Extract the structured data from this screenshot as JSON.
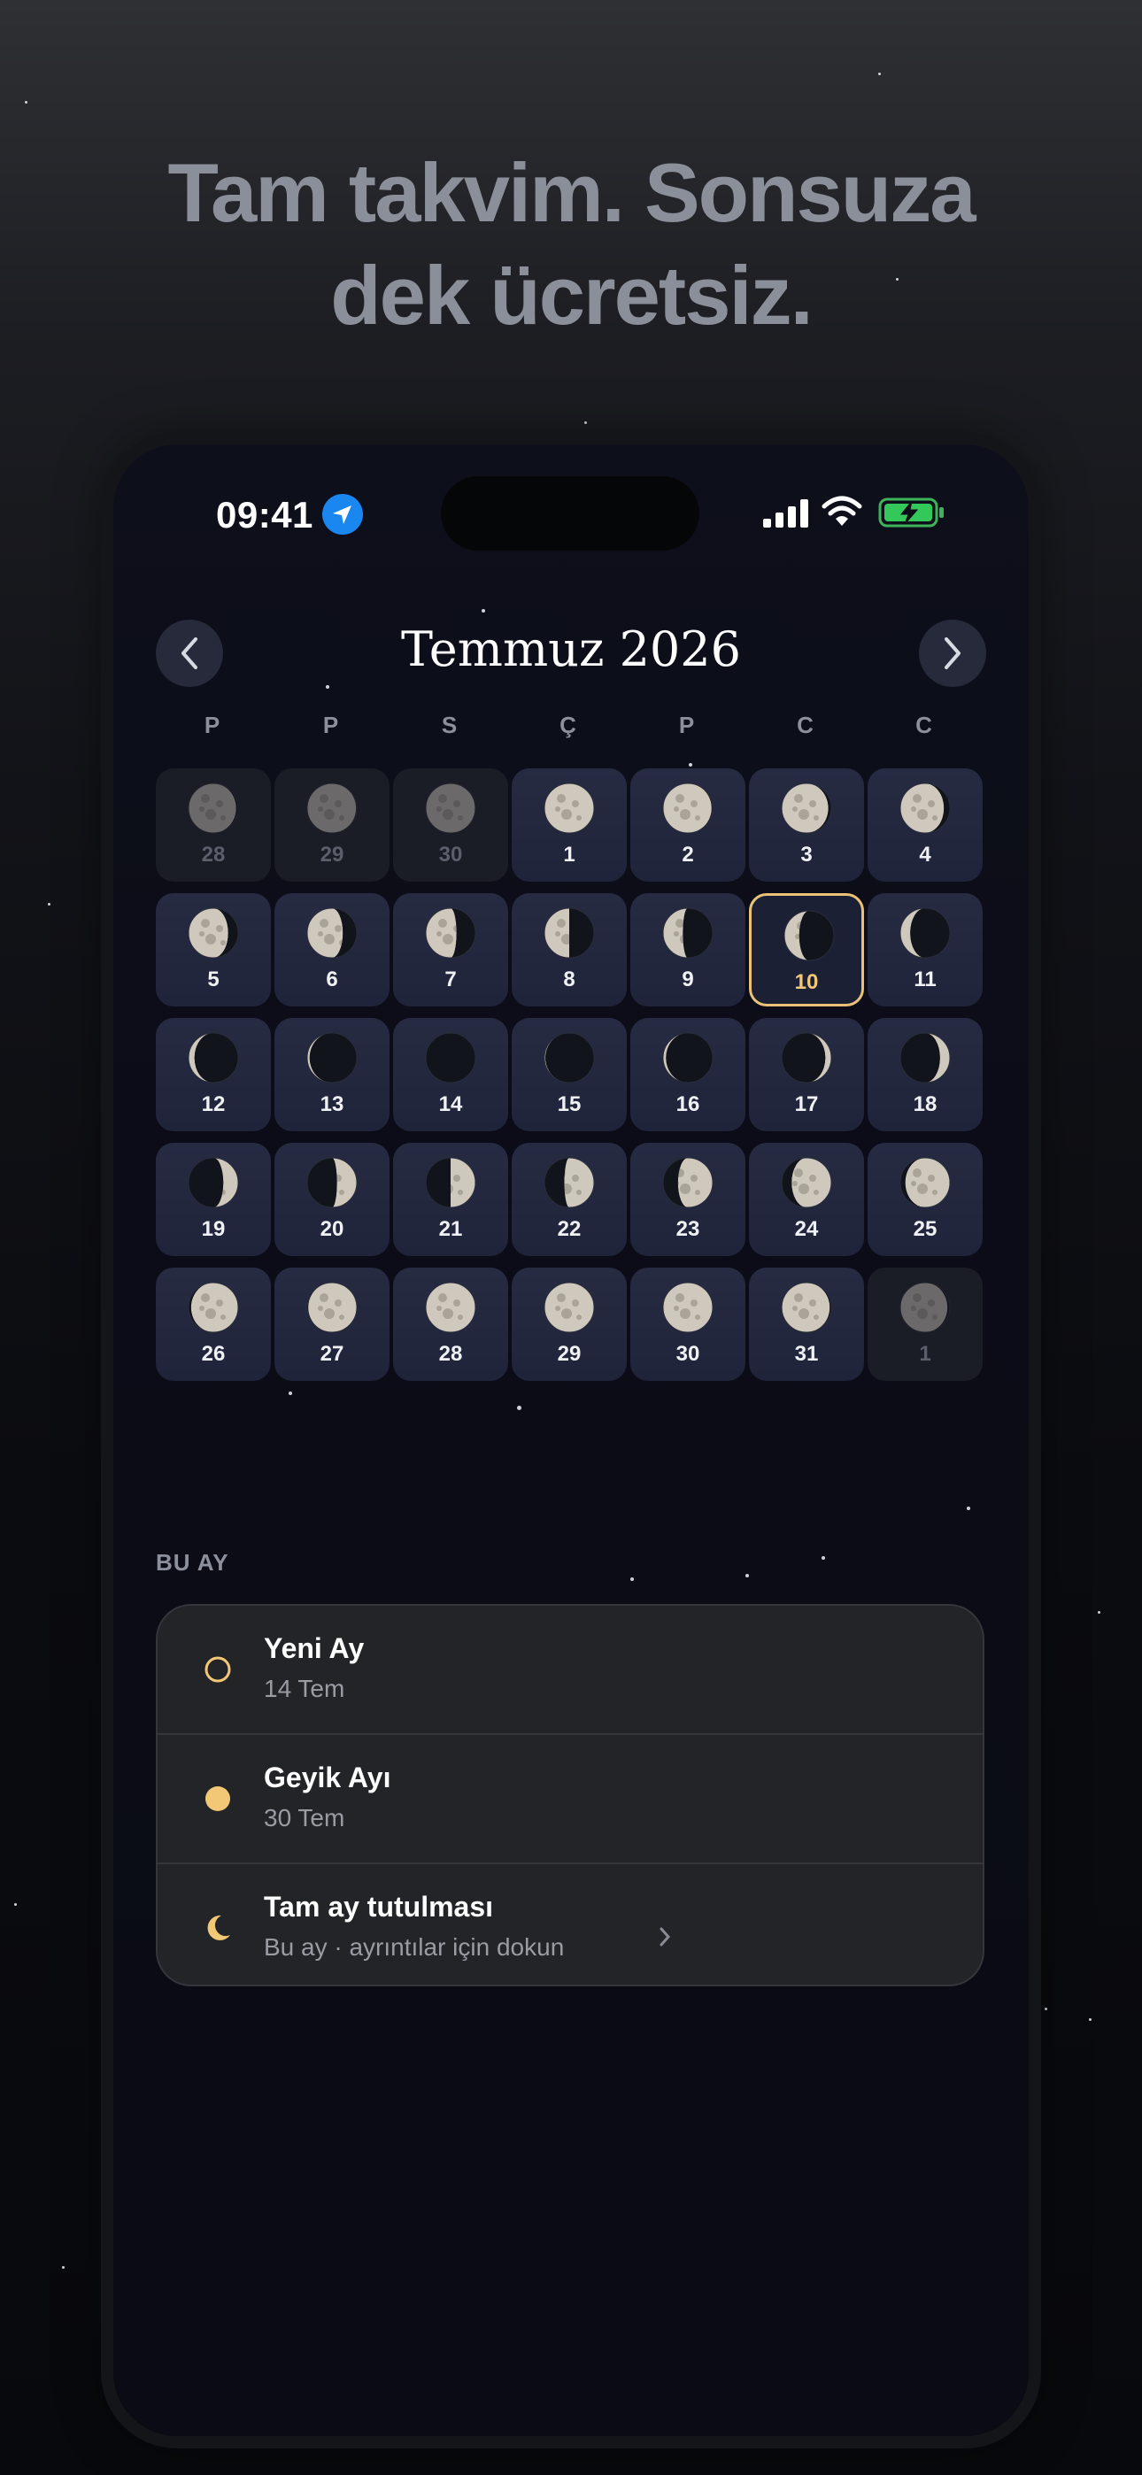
{
  "headline": {
    "line1": "Tam takvim. Sonsuza",
    "line2": "dek ücretsiz."
  },
  "status": {
    "time": "09:41",
    "icons": [
      "location-arrow-icon",
      "cellular-signal-icon",
      "wifi-icon",
      "battery-charging-icon"
    ]
  },
  "calendar": {
    "title": "Temmuz 2026",
    "prev_icon": "chevron-left-icon",
    "next_icon": "chevron-right-icon",
    "weekdays": [
      "P",
      "P",
      "S",
      "Ç",
      "P",
      "C",
      "C"
    ],
    "weeks": [
      [
        {
          "d": "28",
          "p": 0.96,
          "o": true
        },
        {
          "d": "29",
          "p": 0.985,
          "o": true
        },
        {
          "d": "30",
          "p": 0.99,
          "o": true
        },
        {
          "d": "1",
          "p": 1.0
        },
        {
          "d": "2",
          "p": 0.98
        },
        {
          "d": "3",
          "p": 0.94
        },
        {
          "d": "4",
          "p": 0.88
        }
      ],
      [
        {
          "d": "5",
          "p": 0.8
        },
        {
          "d": "6",
          "p": 0.72
        },
        {
          "d": "7",
          "p": 0.62
        },
        {
          "d": "8",
          "p": 0.5
        },
        {
          "d": "9",
          "p": 0.4
        },
        {
          "d": "10",
          "p": 0.3,
          "today": true
        },
        {
          "d": "11",
          "p": 0.2
        }
      ],
      [
        {
          "d": "12",
          "p": 0.12
        },
        {
          "d": "13",
          "p": 0.05
        },
        {
          "d": "14",
          "p": 0.0
        },
        {
          "d": "15",
          "p": 0.02
        },
        {
          "d": "16",
          "p": 0.06
        },
        {
          "d": "17",
          "p": -0.12
        },
        {
          "d": "18",
          "p": -0.2
        }
      ],
      [
        {
          "d": "19",
          "p": -0.3
        },
        {
          "d": "20",
          "p": -0.4
        },
        {
          "d": "21",
          "p": -0.5
        },
        {
          "d": "22",
          "p": -0.6
        },
        {
          "d": "23",
          "p": -0.7
        },
        {
          "d": "24",
          "p": -0.8
        },
        {
          "d": "25",
          "p": -0.9
        }
      ],
      [
        {
          "d": "26",
          "p": -0.95
        },
        {
          "d": "27",
          "p": -0.98
        },
        {
          "d": "28",
          "p": 1.0
        },
        {
          "d": "29",
          "p": 1.0
        },
        {
          "d": "30",
          "p": 1.0
        },
        {
          "d": "31",
          "p": 0.97
        },
        {
          "d": "1",
          "p": 0.95,
          "o": true
        }
      ]
    ]
  },
  "this_month": {
    "label": "BU AY",
    "events": [
      {
        "title": "Yeni Ay",
        "date": "14 Tem",
        "icon": "new-moon-ring-icon"
      },
      {
        "title": "Geyik Ayı",
        "date": "30 Tem",
        "icon": "full-moon-dot-icon"
      },
      {
        "title": "Tam ay tutulması",
        "date": "Bu ay · ayrıntılar için dokun",
        "icon": "crescent-moon-icon",
        "chevron": "chevron-right-icon"
      }
    ]
  },
  "colors": {
    "accent": "#E9C278",
    "today_number": "#F2C877",
    "cell_bg": "#262B42",
    "card_bg": "#232428"
  }
}
